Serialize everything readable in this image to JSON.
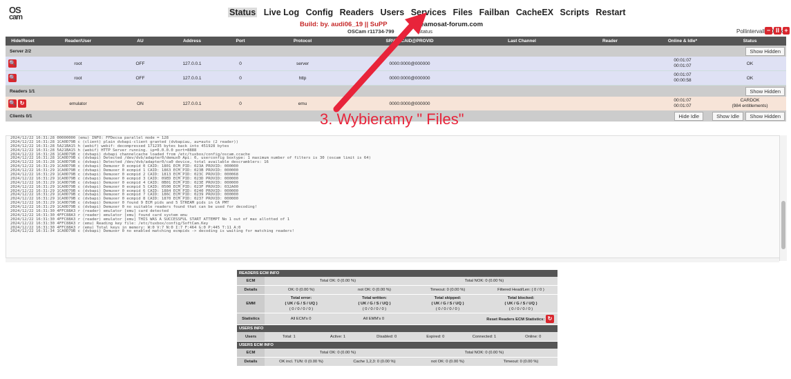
{
  "logo": {
    "line1": "OS",
    "line2": "cam"
  },
  "nav": [
    "Status",
    "Live Log",
    "Config",
    "Readers",
    "Users",
    "Services",
    "Files",
    "Failban",
    "CacheEX",
    "Scripts",
    "Restart"
  ],
  "build": {
    "prefix": "Build: by. audi06_19 || SuPP",
    "suffix": "reamosat-forum.com"
  },
  "version": {
    "name": "OSCam r11734-799",
    "status": "Status"
  },
  "pollinterval": {
    "label": "Pollintervall: 20 sec."
  },
  "poll_buttons": [
    "−",
    "II",
    "+"
  ],
  "columns": [
    "Hide/Reset",
    "Reader/User",
    "AU",
    "Address",
    "Port",
    "Protocol",
    "SRVID:CAID@PROVID",
    "Last Channel",
    "Reader",
    "Online & Idle*",
    "Status"
  ],
  "server_section": {
    "title": "Server 2/2",
    "show_hidden": "Show Hidden"
  },
  "servers": [
    {
      "user": "root",
      "au": "OFF",
      "address": "127.0.0.1",
      "port": "0",
      "protocol": "server",
      "srvid": "0000:0000@000000",
      "online": "00:01:07",
      "idle": "00:01:07",
      "status": "OK"
    },
    {
      "user": "root",
      "au": "OFF",
      "address": "127.0.0.1",
      "port": "0",
      "protocol": "http",
      "srvid": "0000:0000@000000",
      "online": "00:01:07",
      "idle": "00:00:58",
      "status": "OK"
    }
  ],
  "reader_section": {
    "title": "Readers 1/1",
    "show_hidden": "Show Hidden"
  },
  "readers": [
    {
      "user": "emulator",
      "au": "ON",
      "address": "127.0.0.1",
      "port": "0",
      "protocol": "emu",
      "srvid": "0000:0000@000000",
      "online": "00:01:07",
      "idle": "00:01:07",
      "status": "CARDOK",
      "status2": "(984 entitlements)"
    }
  ],
  "clients_section": {
    "title": "Clients 0/1",
    "hide_idle": "Hide Idle",
    "show_idle": "Show Idle",
    "show_hidden": "Show Hidden"
  },
  "overlay": "3. Wybieramy \" Files\"",
  "log": [
    "2024/12/22 16:31:28 00000000 (emu) INFO: FFDecsa parallel mode = 128",
    "2024/12/22 16:31:28 1CA0D79B c (client) plain dvbapi-client granted (dvbapiau, au=auto (2 reader))",
    "2024/12/22 16:31:28 5A21BA15 h (webif) webif: decompressed 171235 bytes back into 451928 bytes",
    "2024/12/22 16:31:28 5A21BA15 h (webif) HTTP Server running. ip=0.0.0.0 port=8888",
    "2024/12/22 16:31:28 1CA0D79B c (dvbapi) dvbapi channelcache loaded from /etc/tuxbox/config/oscam.ccache",
    "2024/12/22 16:31:28 1CA0D79B c (dvbapi) Detected /dev/dvb/adapter0/demux0 Api: 0, userconfig boxtype: 1 maximum number of filters is 30 (oscam limit is 64)",
    "2024/12/22 16:31:28 1CA0D79B c (dvbapi) Detected /dev/dvb/adapter0/ca0 device, total available descramblers: 16",
    "2024/12/22 16:31:29 1CA0D79B c (dvbapi) Demuxer 0 ecmpid 0 CAID: 1801 ECM_PID: 023A PROVID: 000000",
    "2024/12/22 16:31:29 1CA0D79B c (dvbapi) Demuxer 0 ecmpid 1 CAID: 1863 ECM_PID: 023B PROVID: 000000",
    "2024/12/22 16:31:29 1CA0D79B c (dvbapi) Demuxer 0 ecmpid 2 CAID: 1813 ECM_PID: 023C PROVID: 000068",
    "2024/12/22 16:31:29 1CA0D79B c (dvbapi) Demuxer 0 ecmpid 3 CAID: 09ED ECM_PID: 023D PROVID: 000000",
    "2024/12/22 16:31:29 1CA0D79B c (dvbapi) Demuxer 0 ecmpid 4 CAID: 0B01 ECM_PID: 023E PROVID: 000000",
    "2024/12/22 16:31:29 1CA0D79B c (dvbapi) Demuxer 0 ecmpid 5 CAID: 0500 ECM_PID: 023F PROVID: 032A00",
    "2024/12/22 16:31:29 1CA0D79B c (dvbapi) Demuxer 0 ecmpid 6 CAID: 1884 ECM_PID: 0240 PROVID: 000000",
    "2024/12/22 16:31:29 1CA0D79B c (dvbapi) Demuxer 0 ecmpid 7 CAID: 186C ECM_PID: 0239 PROVID: 000000",
    "2024/12/22 16:31:29 1CA0D79B c (dvbapi) Demuxer 0 ecmpid 8 CAID: 1870 ECM_PID: 0237 PROVID: 000000",
    "2024/12/22 16:31:29 1CA0D79B c (dvbapi) Demuxer 0 found 9 ECM pids and 5 STREAM pids in CA PMT",
    "2024/12/22 16:31:29 1CA0D79B c (dvbapi) Demuxer 0 no suitable readers found that can be used for decoding!",
    "2024/12/22 16:31:30 4FFC88A3 r (reader) emulator [emu] card detected",
    "2024/12/22 16:31:30 4FFC88A3 r (reader) emulator [emu] found card system emu",
    "2024/12/22 16:31:30 4FFC88A3 r (reader) emulator [emu] THIS WAS A SUCCESSFUL START ATTEMPT No 1 out of max allotted of 1",
    "2024/12/22 16:31:30 4FFC88A3 r (emu) Reading key file: /etc/tuxbox/config/SoftCam.Key",
    "2024/12/22 16:31:30 4FFC88A3 r (emu) Total keys in memory: W:0 V:7 N:0 I:7 F:464 G:0 P:445 T:11 A:0",
    "2024/12/22 16:31:34 1CA0D79B c (dvbapi) Demuxer 0 no enabled matching ecmpids -> decoding is waiting for matching readers!"
  ],
  "readers_ecm": {
    "title": "READERS ECM INFO",
    "ecm_label": "ECM",
    "total_ok": "Total OK: 0 (0.00 %)",
    "total_nok": "Total NOK: 0 (0.00 %)",
    "details_label": "Details",
    "ok": "OK: 0 (0.00 %)",
    "not_ok": "not OK: 0 (0.00 %)",
    "timeout": "Timeout: 0 (0.00 %)",
    "filtered": "Filtered Head/Len: ( 0 / 0 )",
    "emm_label": "EMM",
    "emm_cols": [
      {
        "title": "Total error:",
        "sub": "( UK / G / S / UQ )",
        "val": "( 0 / 0 / 0 / 0 )"
      },
      {
        "title": "Total written:",
        "sub": "( UK / G / S / UQ )",
        "val": "( 0 / 0 / 0 / 0 )"
      },
      {
        "title": "Total skipped:",
        "sub": "( UK / G / S / UQ )",
        "val": "( 0 / 0 / 0 / 0 )"
      },
      {
        "title": "Total blocked:",
        "sub": "( UK / G / S / UQ )",
        "val": "( 0 / 0 / 0 / 0 )"
      }
    ],
    "stats_label": "Statistics",
    "all_ecms": "All ECM's 0",
    "all_emms": "All EMM's 0",
    "reset": "Reset Readers ECM Statistics:"
  },
  "users_info": {
    "title": "USERS INFO",
    "label": "Users",
    "total": "Total: 1",
    "active": "Active: 1",
    "disabled": "Disabled: 0",
    "expired": "Expired: 0",
    "connected": "Connected: 1",
    "online": "Online: 0"
  },
  "users_ecm": {
    "title": "USERS ECM INFO",
    "ecm_label": "ECM",
    "total_ok": "Total OK: 0 (0.00 %)",
    "total_nok": "Total NOK: 0 (0.00 %)",
    "details_label": "Details",
    "ok_incl": "OK incl. TUN: 0 (0.00 %)",
    "cache": "Cache 1,2,3: 0 (0.00 %)",
    "not_ok": "not OK: 0 (0.00 %)",
    "timeout": "Timeout: 0 (0.00 %)"
  },
  "colors": {
    "accent": "#d9272e",
    "arrow": "#e8243a",
    "header": "#555555",
    "server_row": "#dfe1f4",
    "reader_row": "#f7e4d8"
  }
}
